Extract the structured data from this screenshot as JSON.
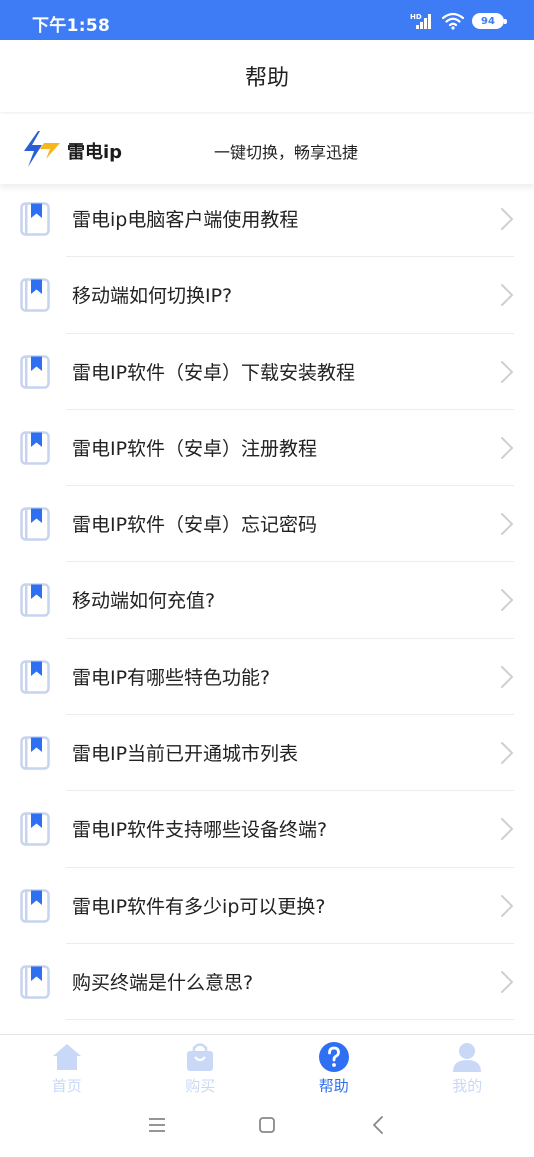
{
  "status_bar": {
    "time": "下午1:58",
    "network_label": "HD",
    "battery": "94"
  },
  "header": {
    "title": "帮助"
  },
  "banner": {
    "brand_name": "雷电ip",
    "slogan": "一键切换，畅享迅捷"
  },
  "help_items": [
    {
      "label": "雷电ip电脑客户端使用教程"
    },
    {
      "label": "移动端如何切换IP?"
    },
    {
      "label": "雷电IP软件（安卓）下载安装教程"
    },
    {
      "label": "雷电IP软件（安卓）注册教程"
    },
    {
      "label": "雷电IP软件（安卓）忘记密码"
    },
    {
      "label": "移动端如何充值?"
    },
    {
      "label": "雷电IP有哪些特色功能?"
    },
    {
      "label": "雷电IP当前已开通城市列表"
    },
    {
      "label": "雷电IP软件支持哪些设备终端?"
    },
    {
      "label": "雷电IP软件有多少ip可以更换?"
    },
    {
      "label": "购买终端是什么意思?"
    },
    {
      "label": ""
    }
  ],
  "tab_bar": {
    "tabs": [
      {
        "label": "首页",
        "icon": "home-icon",
        "active": false
      },
      {
        "label": "购买",
        "icon": "shopping-bag-icon",
        "active": false
      },
      {
        "label": "帮助",
        "icon": "help-icon",
        "active": true
      },
      {
        "label": "我的",
        "icon": "user-icon",
        "active": false
      }
    ]
  },
  "colors": {
    "status_bar": "#3d7cf4",
    "accent": "#2f6ff2",
    "inactive_tab": "#c9d8f7",
    "brand_yellow": "#f5b81c"
  }
}
